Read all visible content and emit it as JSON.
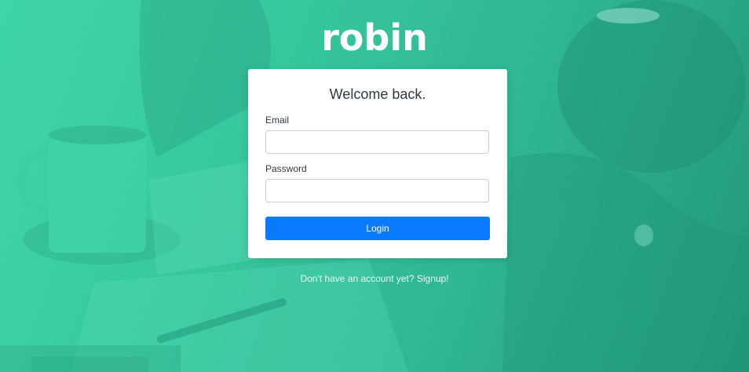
{
  "brand": {
    "logo_text": "robin"
  },
  "login_card": {
    "title": "Welcome back.",
    "email_label": "Email",
    "email_value": "",
    "password_label": "Password",
    "password_value": "",
    "login_button": "Login"
  },
  "footer": {
    "prompt_text": "Don't have an account yet?",
    "signup_link": "Signup!"
  },
  "colors": {
    "background_accent": "#36c79c",
    "primary_button": "#0a7bff",
    "card_background": "#ffffff"
  }
}
